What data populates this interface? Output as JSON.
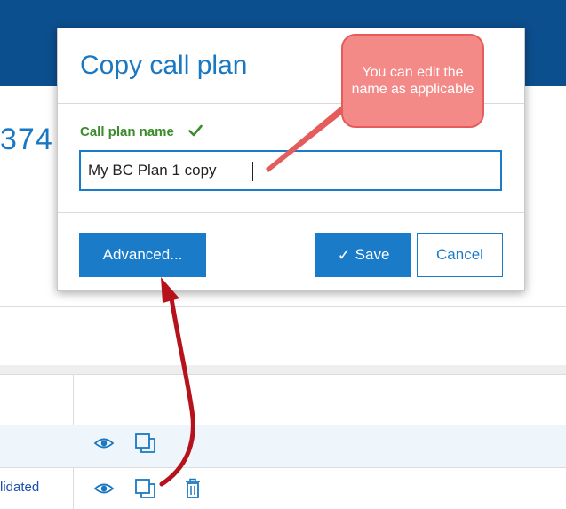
{
  "background": {
    "page_number_fragment": "374",
    "row_status": "lidated",
    "colors": {
      "topbar": "#0c4f8f",
      "accent": "#1a78c2"
    }
  },
  "dialog": {
    "title": "Copy call plan",
    "field_label": "Call plan name",
    "field_value": "My BC Plan 1 copy",
    "buttons": {
      "advanced": "Advanced...",
      "save": "Save",
      "cancel": "Cancel"
    }
  },
  "annotation": {
    "callout_text": "You can edit the name as applicable",
    "colors": {
      "fill": "#f48a88",
      "border": "#e45c5b",
      "arrow": "#b5121b"
    }
  },
  "icons": [
    "check-icon",
    "eye-icon",
    "copy-icon",
    "trash-icon"
  ]
}
